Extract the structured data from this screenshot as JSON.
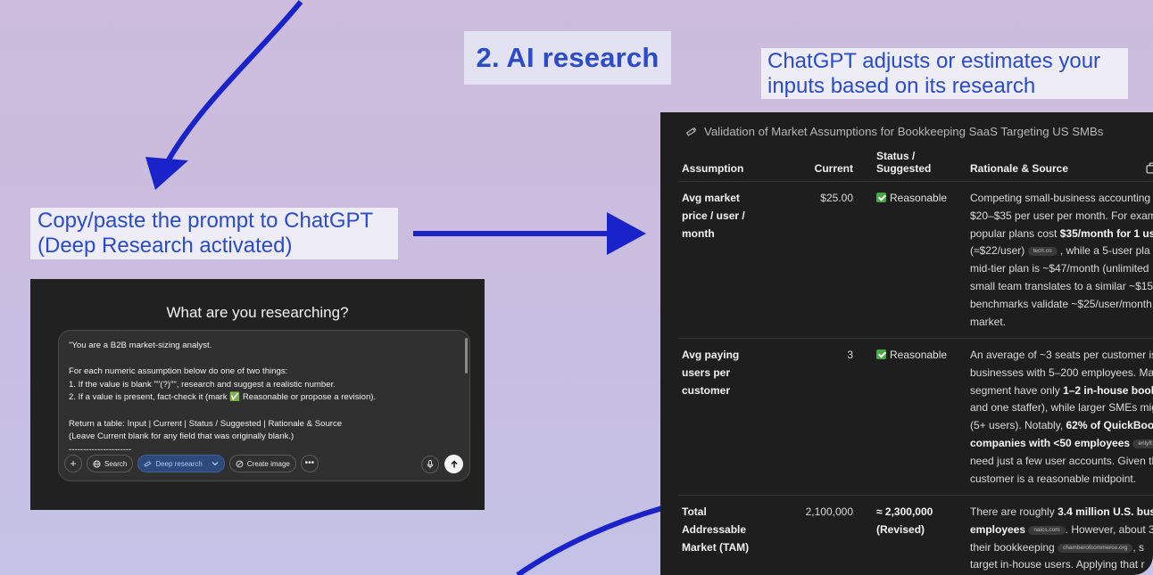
{
  "step_title": "2. AI research",
  "note_right": "ChatGPT adjusts or estimates your\ninputs based on its research",
  "note_left": "Copy/paste the prompt to ChatGPT\n(Deep Research activated)",
  "colors": {
    "accent": "#2b4cc4",
    "arrow": "#1a23c9",
    "background": "#cabfdf"
  },
  "prompt_card": {
    "heading": "What are you researching?",
    "prompt_text": "\"You are a B2B market-sizing analyst.\n\nFor each numeric assumption below do one of two things:\n1. If the value is blank \"\"(?)\"\", research and suggest a realistic number.\n2. If a value is present, fact-check it (mark ✅ Reasonable or propose a revision).\n\nReturn a table: Input | Current | Status / Suggested | Rationale & Source\n(Leave Current blank for any field that was originally blank.)\n----------------------",
    "toolbar": {
      "add_icon": "plus-icon",
      "search_label": "Search",
      "deep_research_label": "Deep research",
      "create_image_label": "Create image",
      "more_icon": "ellipsis-icon",
      "mic_icon": "microphone-icon",
      "send_icon": "arrow-up-icon"
    }
  },
  "research": {
    "title": "Validation of Market Assumptions for Bookkeeping SaaS Targeting US SMBs",
    "headers": {
      "assumption": "Assumption",
      "current": "Current",
      "status_line1": "Status /",
      "status_line2": "Suggested",
      "rationale": "Rationale & Source"
    },
    "rows": [
      {
        "assumption": "Avg market price / user / month",
        "current": "$25.00",
        "status": "Reasonable",
        "rationale_lines": [
          "Competing small-business accounting",
          "$20–$35 per user per month. For exam",
          "popular plans cost $35/month for 1 us",
          "(≈$22/user) [tech.co] , while a 5-user pla",
          "mid-tier plan is ~$47/month (unlimited",
          "small team translates to a similar ~$15",
          "benchmarks validate ~$25/user/month",
          "market."
        ],
        "bold_phrase": "$35/month for 1 us",
        "chip": "tech.co"
      },
      {
        "assumption": "Avg paying users per customer",
        "current": "3",
        "status": "Reasonable",
        "rationale_lines": [
          "An average of ~3 seats per customer is",
          "businesses with 5–200 employees. Ma",
          "segment have only 1–2 in-house book",
          "and one staffer), while larger SMEs mig",
          "(5+ users). Notably, 62% of QuickBoo",
          "companies with <50 employees",
          "need just a few user accounts. Given th",
          "customer is a reasonable midpoint."
        ],
        "chip": "enlyft"
      },
      {
        "assumption": "Total Addressable Market (TAM)",
        "current": "2,100,000",
        "status": "≈ 2,300,000 (Revised)",
        "rationale_lines": [
          "There are roughly 3.4 million U.S. bus",
          "employees . However, about 3",
          "their bookkeeping",
          "target in-house users. Applying that r"
        ],
        "chip": "naics.com",
        "chip2": "chamberofcommerce.org"
      }
    ]
  }
}
